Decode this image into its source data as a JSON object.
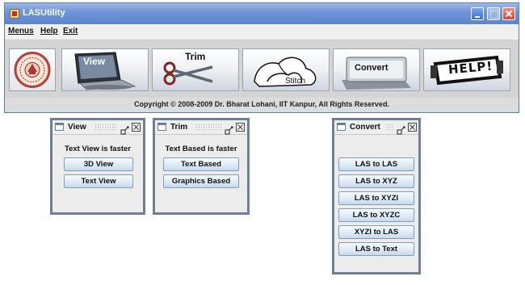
{
  "window": {
    "title": "LASUtility"
  },
  "menubar": {
    "items": [
      "Menus",
      "Help",
      "Exit"
    ]
  },
  "toolbar": {
    "tools": [
      {
        "name": "View"
      },
      {
        "name": "Trim"
      },
      {
        "name": "Stitch"
      },
      {
        "name": "Convert"
      },
      {
        "name": "HELP!"
      }
    ]
  },
  "footer": {
    "copyright": "Copyright © 2008-2009 Dr. Bharat Lohani, IIT Kanpur, All Rights Reserved."
  },
  "frames": {
    "view": {
      "title": "View",
      "info": "Text View is faster",
      "buttons": [
        "3D View",
        "Text View"
      ]
    },
    "trim": {
      "title": "Trim",
      "info": "Text Based is faster",
      "buttons": [
        "Text Based",
        "Graphics Based"
      ]
    },
    "convert": {
      "title": "Convert",
      "buttons": [
        "LAS to LAS",
        "LAS to XYZ",
        "LAS to XYZI",
        "LAS to XYZC",
        "XYZI to LAS",
        "LAS to Text"
      ]
    }
  },
  "colors": {
    "titlebar": "#5a84cf",
    "frame_border": "#6f7f94",
    "button_border": "#7f9dba"
  }
}
